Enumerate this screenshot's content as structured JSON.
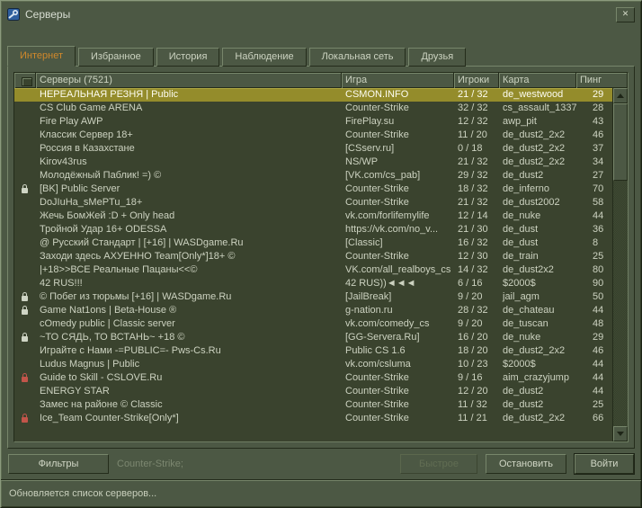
{
  "window": {
    "title": "Серверы",
    "close_glyph": "✕"
  },
  "colors": {
    "background": "#4c5844",
    "list_background": "#3a432e",
    "text": "#ccd2c0",
    "active_tab_text": "#d0882b",
    "selected_row": "#948c2b",
    "selected_row_text": "#ffffff",
    "lock_red": "#c2554a"
  },
  "tabs": [
    {
      "label": "Интернет",
      "active": true
    },
    {
      "label": "Избранное",
      "active": false
    },
    {
      "label": "История",
      "active": false
    },
    {
      "label": "Наблюдение",
      "active": false
    },
    {
      "label": "Локальная сеть",
      "active": false
    },
    {
      "label": "Друзья",
      "active": false
    }
  ],
  "table": {
    "columns": [
      "Серверы (7521)",
      "Игра",
      "Игроки",
      "Карта",
      "Пинг"
    ],
    "rows": [
      {
        "icon": "",
        "name": "НЕРЕАЛЬНАЯ РЕЗНЯ | Public",
        "game": "CSMON.INFO",
        "players": "21 / 32",
        "map": "de_westwood",
        "ping": "29",
        "selected": true
      },
      {
        "icon": "",
        "name": "CS Club Game ARENA",
        "game": "Counter-Strike",
        "players": "32 / 32",
        "map": "cs_assault_1337",
        "ping": "28",
        "selected": false
      },
      {
        "icon": "",
        "name": "Fire Play AWP",
        "game": "FirePlay.su",
        "players": "12 / 32",
        "map": "awp_pit",
        "ping": "43",
        "selected": false
      },
      {
        "icon": "",
        "name": "Классик Сервер 18+",
        "game": "Counter-Strike",
        "players": "11 / 20",
        "map": "de_dust2_2x2",
        "ping": "46",
        "selected": false
      },
      {
        "icon": "",
        "name": "Россия в Казахстане",
        "game": "[CSserv.ru]",
        "players": "0 / 18",
        "map": "de_dust2_2x2",
        "ping": "37",
        "selected": false
      },
      {
        "icon": "",
        "name": "Kirov43rus",
        "game": "NS/WP",
        "players": "21 / 32",
        "map": "de_dust2_2x2",
        "ping": "34",
        "selected": false
      },
      {
        "icon": "",
        "name": "Молодёжный Паблик! =) ©",
        "game": "[VK.com/cs_pab]",
        "players": "29 / 32",
        "map": "de_dust2",
        "ping": "27",
        "selected": false
      },
      {
        "icon": "lock",
        "name": "[BK] Public Server",
        "game": "Counter-Strike",
        "players": "18 / 32",
        "map": "de_inferno",
        "ping": "70",
        "selected": false
      },
      {
        "icon": "",
        "name": "DoJIuHa_sMePTu_18+",
        "game": "Counter-Strike",
        "players": "21 / 32",
        "map": "de_dust2002",
        "ping": "58",
        "selected": false
      },
      {
        "icon": "",
        "name": "Жечь БомЖей :D + Only head",
        "game": "vk.com/forlifemylife",
        "players": "12 / 14",
        "map": "de_nuke",
        "ping": "44",
        "selected": false
      },
      {
        "icon": "",
        "name": "Тройной Удар 16+ ODESSA",
        "game": "https://vk.com/no_v...",
        "players": "21 / 30",
        "map": "de_dust",
        "ping": "36",
        "selected": false
      },
      {
        "icon": "",
        "name": "@ Русский Стандарт | [+16] | WASDgame.Ru",
        "game": "[Classic]",
        "players": "16 / 32",
        "map": "de_dust",
        "ping": "8",
        "selected": false
      },
      {
        "icon": "",
        "name": "Заходи здесь АХУЕННО Team[Only*]18+ ©",
        "game": "Counter-Strike",
        "players": "12 / 30",
        "map": "de_train",
        "ping": "25",
        "selected": false
      },
      {
        "icon": "",
        "name": "|+18>>ВСЕ Реальные Пацаны<<©",
        "game": "VK.com/all_realboys_cs",
        "players": "14 / 32",
        "map": "de_dust2x2",
        "ping": "80",
        "selected": false
      },
      {
        "icon": "",
        "name": "42 RUS!!!",
        "game": "42 RUS))◄◄◄",
        "players": "6 / 16",
        "map": "$2000$",
        "ping": "90",
        "selected": false
      },
      {
        "icon": "lock",
        "name": "© Побег из тюрьмы [+16] | WASDgame.Ru",
        "game": "[JailBreak]",
        "players": "9 / 20",
        "map": "jail_agm",
        "ping": "50",
        "selected": false
      },
      {
        "icon": "lock",
        "name": "Game Nat1ons | Beta-House ®",
        "game": "g-nation.ru",
        "players": "28 / 32",
        "map": "de_chateau",
        "ping": "44",
        "selected": false
      },
      {
        "icon": "",
        "name": "cOmedy public | Classic server",
        "game": "vk.com/comedy_cs",
        "players": "9 / 20",
        "map": "de_tuscan",
        "ping": "48",
        "selected": false
      },
      {
        "icon": "lock",
        "name": "~ТО СЯДЬ, ТО ВСТАНЬ~ +18 ©",
        "game": "[GG-Servera.Ru]",
        "players": "16 / 20",
        "map": "de_nuke",
        "ping": "29",
        "selected": false
      },
      {
        "icon": "",
        "name": "Играйте с Нами -=PUBLIC=- Pws-Cs.Ru",
        "game": "Public CS 1.6",
        "players": "18 / 20",
        "map": "de_dust2_2x2",
        "ping": "46",
        "selected": false
      },
      {
        "icon": "",
        "name": "Ludus Magnus | Public",
        "game": "vk.com/csluma",
        "players": "10 / 23",
        "map": "$2000$",
        "ping": "44",
        "selected": false
      },
      {
        "icon": "lock-red",
        "name": "Guide to Skill -  CSLOVE.Ru",
        "game": "Counter-Strike",
        "players": "9 / 16",
        "map": "aim_crazyjump",
        "ping": "44",
        "selected": false
      },
      {
        "icon": "",
        "name": "ENERGY STAR",
        "game": "Counter-Strike",
        "players": "12 / 20",
        "map": "de_dust2",
        "ping": "44",
        "selected": false
      },
      {
        "icon": "",
        "name": "Замес на районе © Classic",
        "game": "Counter-Strike",
        "players": "11 / 32",
        "map": "de_dust2",
        "ping": "25",
        "selected": false
      },
      {
        "icon": "lock-red",
        "name": "Ice_Team Counter-Strike[Only*]",
        "game": "Counter-Strike",
        "players": "11 / 21",
        "map": "de_dust2_2x2",
        "ping": "66",
        "selected": false
      }
    ]
  },
  "footer": {
    "filters": "Фильтры",
    "filter_value": "Counter-Strike;",
    "quick": "Быстрое",
    "stop": "Остановить",
    "connect": "Войти"
  },
  "status": "Обновляется список серверов..."
}
